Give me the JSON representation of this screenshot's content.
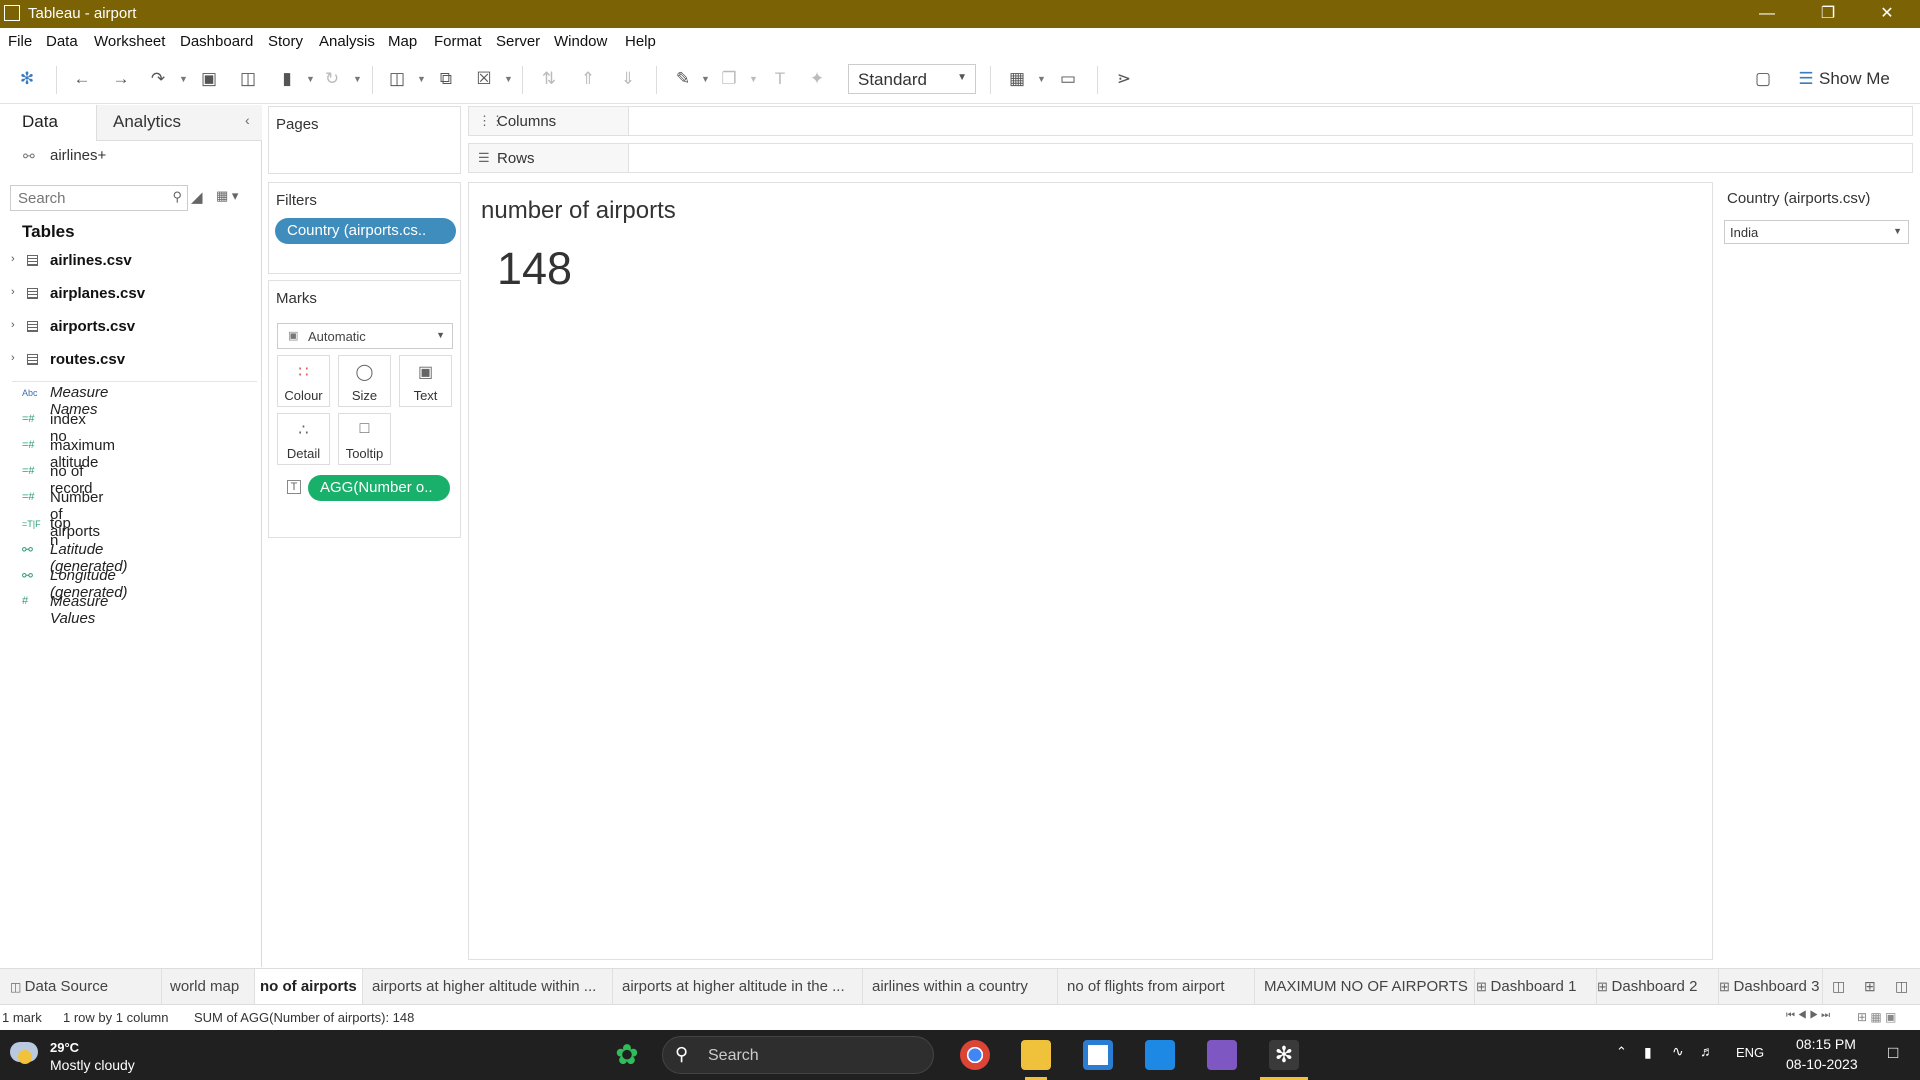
{
  "window": {
    "title": "Tableau - airport"
  },
  "menu": [
    "File",
    "Data",
    "Worksheet",
    "Dashboard",
    "Story",
    "Analysis",
    "Map",
    "Format",
    "Server",
    "Window",
    "Help"
  ],
  "toolbar": {
    "fit_value": "Standard",
    "show_me": "Show Me"
  },
  "data_pane": {
    "tabs": [
      "Data",
      "Analytics"
    ],
    "datasource": "airlines+",
    "search_placeholder": "Search",
    "tables_heading": "Tables",
    "tables": [
      "airlines.csv",
      "airplanes.csv",
      "airports.csv",
      "routes.csv"
    ],
    "fields": [
      {
        "label": "Measure Names",
        "icon": "Abc",
        "italic": true
      },
      {
        "label": "index no",
        "icon": "=#",
        "italic": false
      },
      {
        "label": "maximum altitude",
        "icon": "=#",
        "italic": false
      },
      {
        "label": "no of record",
        "icon": "=#",
        "italic": false
      },
      {
        "label": "Number of airports",
        "icon": "=#",
        "italic": false
      },
      {
        "label": "top n",
        "icon": "=T|F",
        "italic": false
      },
      {
        "label": "Latitude (generated)",
        "icon": "globe",
        "italic": true
      },
      {
        "label": "Longitude (generated)",
        "icon": "globe",
        "italic": true
      },
      {
        "label": "Measure Values",
        "icon": "#",
        "italic": true
      }
    ]
  },
  "cards": {
    "pages": "Pages",
    "filters": "Filters",
    "filter_pill": "Country (airports.cs..",
    "marks": "Marks",
    "mark_type": "Automatic",
    "mark_buttons": [
      "Colour",
      "Size",
      "Text",
      "Detail",
      "Tooltip"
    ],
    "mark_pill": "AGG(Number o.."
  },
  "shelves": {
    "columns": "Columns",
    "rows": "Rows"
  },
  "view": {
    "title": "number of airports",
    "value": "148"
  },
  "quick_filter": {
    "title": "Country (airports.csv)",
    "value": "India"
  },
  "sheet_tabs": [
    {
      "label": "Data Source",
      "active": false
    },
    {
      "label": "world map",
      "active": false
    },
    {
      "label": "no of airports",
      "active": true
    },
    {
      "label": "airports at higher altitude within ...",
      "active": false
    },
    {
      "label": "airports at higher altitude in the ...",
      "active": false
    },
    {
      "label": "airlines within a country",
      "active": false
    },
    {
      "label": "no of flights from airport",
      "active": false
    },
    {
      "label": "MAXIMUM NO OF AIRPORTS",
      "active": false
    },
    {
      "label": "Dashboard 1",
      "active": false
    },
    {
      "label": "Dashboard 2",
      "active": false
    },
    {
      "label": "Dashboard 3",
      "active": false
    }
  ],
  "status": {
    "marks": "1 mark",
    "rows": "1 row  by  1 column",
    "sum": "SUM of AGG(Number of airports): 148"
  },
  "taskbar": {
    "temp": "29°C",
    "weather": "Mostly cloudy",
    "search": "Search",
    "lang": "ENG",
    "time": "08:15 PM",
    "date": "08-10-2023"
  },
  "colors": {
    "titlebar": "#7b6205",
    "filter_pill": "#3e8dbd",
    "measure_pill": "#18b06b"
  }
}
